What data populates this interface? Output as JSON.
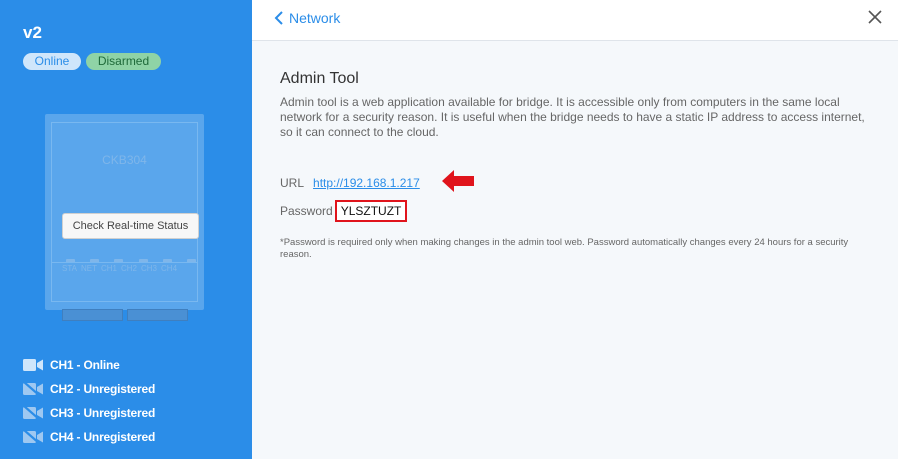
{
  "device": {
    "name": "v2",
    "status_online": "Online",
    "status_armed": "Disarmed",
    "model": "CKB304",
    "check_button": "Check Real-time Status",
    "port_labels": [
      "STA",
      "NET",
      "CH1",
      "CH2",
      "CH3",
      "CH4"
    ]
  },
  "channels": [
    {
      "label": "CH1 - Online",
      "icon": "camera-icon"
    },
    {
      "label": "CH2 - Unregistered",
      "icon": "camera-off-icon"
    },
    {
      "label": "CH3 - Unregistered",
      "icon": "camera-off-icon"
    },
    {
      "label": "CH4 - Unregistered",
      "icon": "camera-off-icon"
    }
  ],
  "header": {
    "back_label": "Network",
    "close_icon": "close-icon"
  },
  "admin": {
    "title": "Admin Tool",
    "description": "Admin tool is a web application available for bridge. It is accessible only from computers in the same local network for a security reason. It is useful when the bridge needs to have a static IP address to access internet, so it can connect to the cloud.",
    "url_label": "URL",
    "url": "http://192.168.1.217",
    "password_label": "Password",
    "password": "YLSZTUZT",
    "note": "*Password is required only when making changes in the admin tool web. Password automatically changes every 24 hours for a security reason."
  },
  "colors": {
    "sidebar": "#2b8de8",
    "accent": "#2b8de8",
    "highlight": "#e0141c",
    "online_badge": "#cfe6fb",
    "disarmed_badge": "#8fd3a6"
  }
}
